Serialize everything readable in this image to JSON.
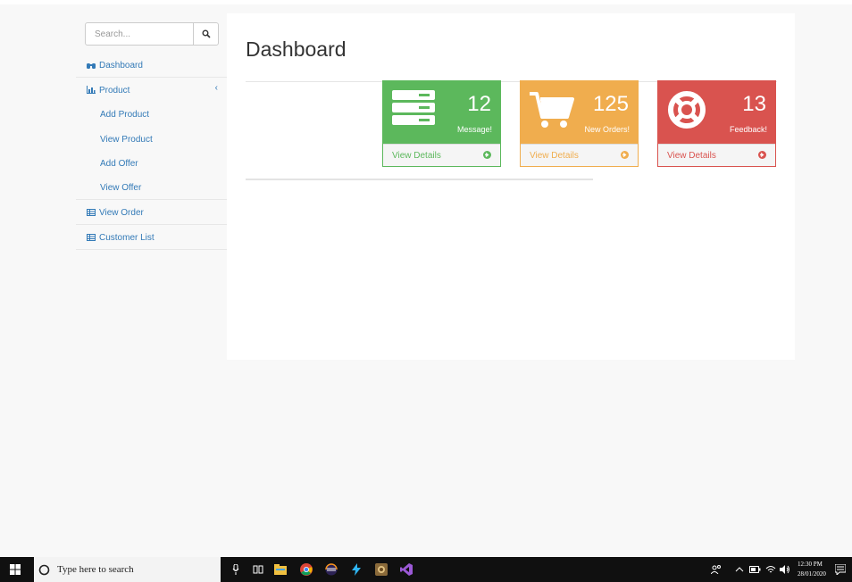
{
  "sidebar": {
    "search_placeholder": "Search...",
    "items": [
      {
        "label": "Dashboard",
        "icon": "dashboard-icon"
      },
      {
        "label": "Product",
        "icon": "bar-chart-icon"
      },
      {
        "label": "View Order",
        "icon": "table-icon"
      },
      {
        "label": "Customer List",
        "icon": "table-icon"
      }
    ],
    "product_subitems": [
      "Add Product",
      "View Product",
      "Add Offer",
      "View Offer"
    ]
  },
  "main": {
    "title": "Dashboard",
    "panels": [
      {
        "count": "12",
        "label": "Message!",
        "link": "View Details",
        "color": "#5cb85c",
        "icon": "server-icon"
      },
      {
        "count": "125",
        "label": "New Orders!",
        "link": "View Details",
        "color": "#f0ad4e",
        "icon": "cart-icon"
      },
      {
        "count": "13",
        "label": "Feedback!",
        "link": "View Details",
        "color": "#d9534f",
        "icon": "lifebuoy-icon"
      }
    ]
  },
  "taskbar": {
    "search_text": "Type here to search",
    "time": "12:30 PM",
    "date": "28/01/2020"
  },
  "colors": {
    "link": "#337ab7",
    "green": "#5cb85c",
    "orange": "#f0ad4e",
    "red": "#d9534f"
  }
}
